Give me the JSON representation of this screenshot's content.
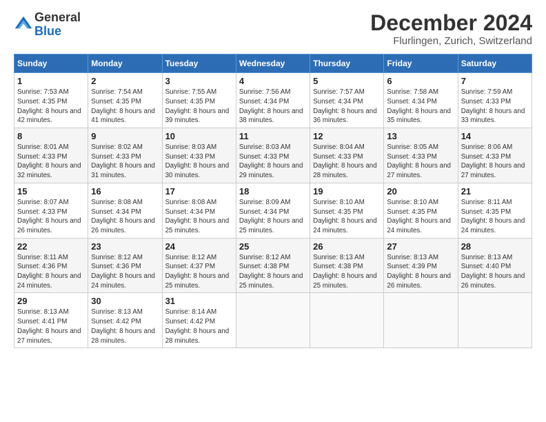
{
  "header": {
    "logo_line1": "General",
    "logo_line2": "Blue",
    "month_title": "December 2024",
    "location": "Flurlingen, Zurich, Switzerland"
  },
  "days_of_week": [
    "Sunday",
    "Monday",
    "Tuesday",
    "Wednesday",
    "Thursday",
    "Friday",
    "Saturday"
  ],
  "weeks": [
    [
      {
        "day": "1",
        "sunrise": "Sunrise: 7:53 AM",
        "sunset": "Sunset: 4:35 PM",
        "daylight": "Daylight: 8 hours and 42 minutes."
      },
      {
        "day": "2",
        "sunrise": "Sunrise: 7:54 AM",
        "sunset": "Sunset: 4:35 PM",
        "daylight": "Daylight: 8 hours and 41 minutes."
      },
      {
        "day": "3",
        "sunrise": "Sunrise: 7:55 AM",
        "sunset": "Sunset: 4:35 PM",
        "daylight": "Daylight: 8 hours and 39 minutes."
      },
      {
        "day": "4",
        "sunrise": "Sunrise: 7:56 AM",
        "sunset": "Sunset: 4:34 PM",
        "daylight": "Daylight: 8 hours and 38 minutes."
      },
      {
        "day": "5",
        "sunrise": "Sunrise: 7:57 AM",
        "sunset": "Sunset: 4:34 PM",
        "daylight": "Daylight: 8 hours and 36 minutes."
      },
      {
        "day": "6",
        "sunrise": "Sunrise: 7:58 AM",
        "sunset": "Sunset: 4:34 PM",
        "daylight": "Daylight: 8 hours and 35 minutes."
      },
      {
        "day": "7",
        "sunrise": "Sunrise: 7:59 AM",
        "sunset": "Sunset: 4:33 PM",
        "daylight": "Daylight: 8 hours and 33 minutes."
      }
    ],
    [
      {
        "day": "8",
        "sunrise": "Sunrise: 8:01 AM",
        "sunset": "Sunset: 4:33 PM",
        "daylight": "Daylight: 8 hours and 32 minutes."
      },
      {
        "day": "9",
        "sunrise": "Sunrise: 8:02 AM",
        "sunset": "Sunset: 4:33 PM",
        "daylight": "Daylight: 8 hours and 31 minutes."
      },
      {
        "day": "10",
        "sunrise": "Sunrise: 8:03 AM",
        "sunset": "Sunset: 4:33 PM",
        "daylight": "Daylight: 8 hours and 30 minutes."
      },
      {
        "day": "11",
        "sunrise": "Sunrise: 8:03 AM",
        "sunset": "Sunset: 4:33 PM",
        "daylight": "Daylight: 8 hours and 29 minutes."
      },
      {
        "day": "12",
        "sunrise": "Sunrise: 8:04 AM",
        "sunset": "Sunset: 4:33 PM",
        "daylight": "Daylight: 8 hours and 28 minutes."
      },
      {
        "day": "13",
        "sunrise": "Sunrise: 8:05 AM",
        "sunset": "Sunset: 4:33 PM",
        "daylight": "Daylight: 8 hours and 27 minutes."
      },
      {
        "day": "14",
        "sunrise": "Sunrise: 8:06 AM",
        "sunset": "Sunset: 4:33 PM",
        "daylight": "Daylight: 8 hours and 27 minutes."
      }
    ],
    [
      {
        "day": "15",
        "sunrise": "Sunrise: 8:07 AM",
        "sunset": "Sunset: 4:33 PM",
        "daylight": "Daylight: 8 hours and 26 minutes."
      },
      {
        "day": "16",
        "sunrise": "Sunrise: 8:08 AM",
        "sunset": "Sunset: 4:34 PM",
        "daylight": "Daylight: 8 hours and 26 minutes."
      },
      {
        "day": "17",
        "sunrise": "Sunrise: 8:08 AM",
        "sunset": "Sunset: 4:34 PM",
        "daylight": "Daylight: 8 hours and 25 minutes."
      },
      {
        "day": "18",
        "sunrise": "Sunrise: 8:09 AM",
        "sunset": "Sunset: 4:34 PM",
        "daylight": "Daylight: 8 hours and 25 minutes."
      },
      {
        "day": "19",
        "sunrise": "Sunrise: 8:10 AM",
        "sunset": "Sunset: 4:35 PM",
        "daylight": "Daylight: 8 hours and 24 minutes."
      },
      {
        "day": "20",
        "sunrise": "Sunrise: 8:10 AM",
        "sunset": "Sunset: 4:35 PM",
        "daylight": "Daylight: 8 hours and 24 minutes."
      },
      {
        "day": "21",
        "sunrise": "Sunrise: 8:11 AM",
        "sunset": "Sunset: 4:35 PM",
        "daylight": "Daylight: 8 hours and 24 minutes."
      }
    ],
    [
      {
        "day": "22",
        "sunrise": "Sunrise: 8:11 AM",
        "sunset": "Sunset: 4:36 PM",
        "daylight": "Daylight: 8 hours and 24 minutes."
      },
      {
        "day": "23",
        "sunrise": "Sunrise: 8:12 AM",
        "sunset": "Sunset: 4:36 PM",
        "daylight": "Daylight: 8 hours and 24 minutes."
      },
      {
        "day": "24",
        "sunrise": "Sunrise: 8:12 AM",
        "sunset": "Sunset: 4:37 PM",
        "daylight": "Daylight: 8 hours and 25 minutes."
      },
      {
        "day": "25",
        "sunrise": "Sunrise: 8:12 AM",
        "sunset": "Sunset: 4:38 PM",
        "daylight": "Daylight: 8 hours and 25 minutes."
      },
      {
        "day": "26",
        "sunrise": "Sunrise: 8:13 AM",
        "sunset": "Sunset: 4:38 PM",
        "daylight": "Daylight: 8 hours and 25 minutes."
      },
      {
        "day": "27",
        "sunrise": "Sunrise: 8:13 AM",
        "sunset": "Sunset: 4:39 PM",
        "daylight": "Daylight: 8 hours and 26 minutes."
      },
      {
        "day": "28",
        "sunrise": "Sunrise: 8:13 AM",
        "sunset": "Sunset: 4:40 PM",
        "daylight": "Daylight: 8 hours and 26 minutes."
      }
    ],
    [
      {
        "day": "29",
        "sunrise": "Sunrise: 8:13 AM",
        "sunset": "Sunset: 4:41 PM",
        "daylight": "Daylight: 8 hours and 27 minutes."
      },
      {
        "day": "30",
        "sunrise": "Sunrise: 8:13 AM",
        "sunset": "Sunset: 4:42 PM",
        "daylight": "Daylight: 8 hours and 28 minutes."
      },
      {
        "day": "31",
        "sunrise": "Sunrise: 8:14 AM",
        "sunset": "Sunset: 4:42 PM",
        "daylight": "Daylight: 8 hours and 28 minutes."
      },
      null,
      null,
      null,
      null
    ]
  ]
}
